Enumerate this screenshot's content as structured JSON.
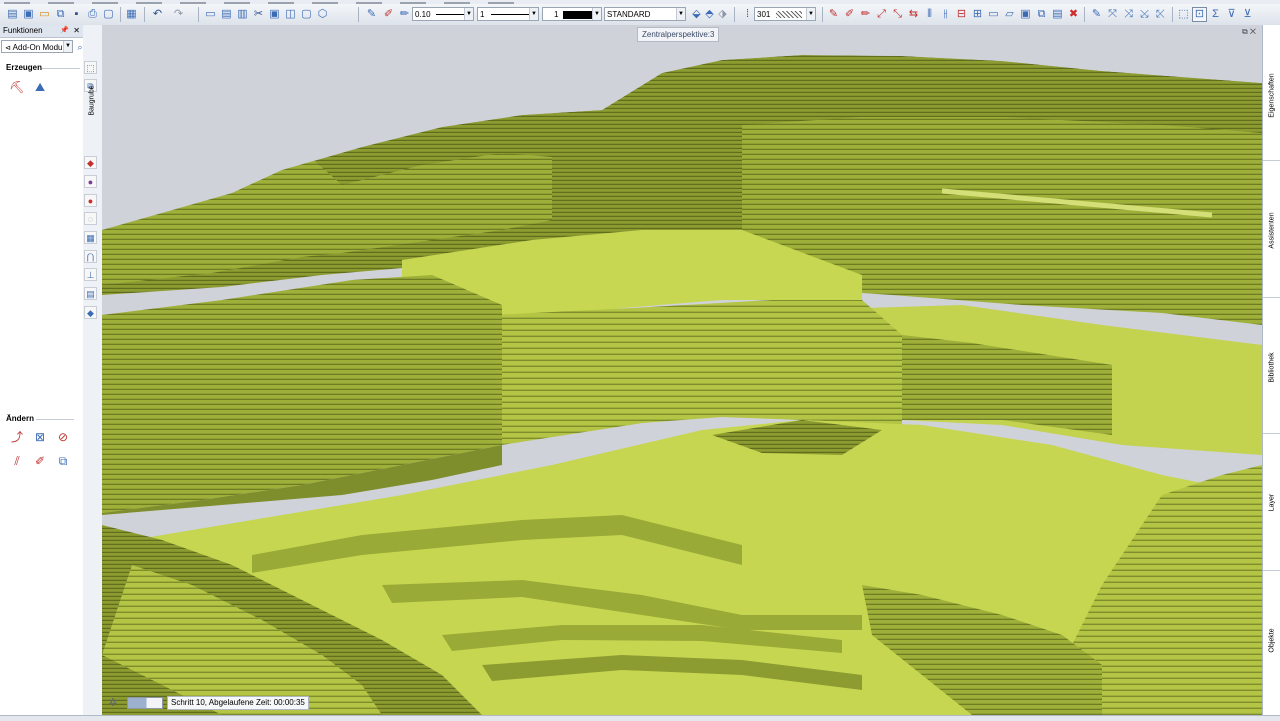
{
  "menubar": {
    "items": [
      "",
      "",
      "",
      "",
      "",
      "",
      "",
      "",
      "",
      "",
      "",
      "",
      "",
      "",
      ""
    ]
  },
  "toolbar": {
    "pen_thickness": "0.10",
    "line_type": "1",
    "color_no": "1",
    "layer": "STANDARD",
    "pattern": "301",
    "icons": [
      "new-file-icon",
      "open-file-icon",
      "save-icon",
      "print-icon",
      "copy-icon",
      "undo-icon",
      "redo-icon",
      "line-icon",
      "rect-icon",
      "measure-icon",
      "zoom-icon"
    ]
  },
  "left_panel": {
    "title": "Funktionen",
    "module_select": "Add-On Modul",
    "section_create": "Erzeugen",
    "section_modify": "Ändern",
    "vertical_tab": "Baugrube"
  },
  "viewport": {
    "tooltip": "Zentralperspektive:3",
    "status_text": "Schritt 10, Abgelaufene Zeit: 00:00:35",
    "progress": 0.55
  },
  "right_panel": {
    "tabs": [
      "Eigenschaften",
      "Assistenten",
      "Bibliothek",
      "Layer",
      "Objekte"
    ]
  },
  "colors": {
    "terrain_light": "#c7d651",
    "terrain_mid": "#a9b93d",
    "terrain_dark": "#7f8e2c",
    "sky": "#cfd2d9",
    "panel_header": "#dfe5ee"
  }
}
